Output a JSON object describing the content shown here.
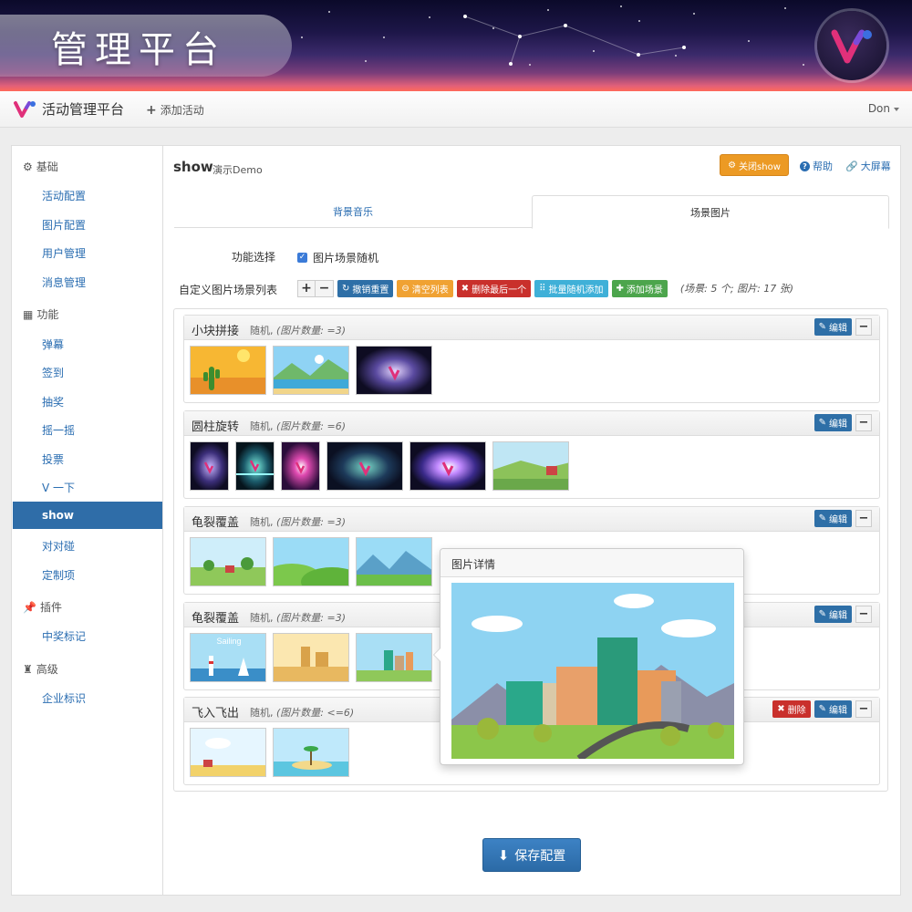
{
  "banner": {
    "title": "管理平台"
  },
  "navbar": {
    "brand": "活动管理平台",
    "add_activity": "添加活动",
    "user": "Don"
  },
  "sidebar": {
    "groups": [
      {
        "label": "基础",
        "icon": "gear-icon",
        "items": [
          "活动配置",
          "图片配置",
          "用户管理",
          "消息管理"
        ]
      },
      {
        "label": "功能",
        "icon": "grid-icon",
        "items": [
          "弹幕",
          "签到",
          "抽奖",
          "摇一摇",
          "投票",
          "V 一下",
          "show",
          "对对碰",
          "定制项"
        ]
      },
      {
        "label": "插件",
        "icon": "pin-icon",
        "items": [
          "中奖标记"
        ]
      },
      {
        "label": "高级",
        "icon": "stamp-icon",
        "items": [
          "企业标识"
        ]
      }
    ],
    "active": "show"
  },
  "main": {
    "title": "show",
    "subtitle": "演示Demo",
    "close_show": "关闭show",
    "help": "帮助",
    "big_screen": "大屏幕",
    "tabs": [
      "背景音乐",
      "场景图片"
    ],
    "active_tab": "场景图片",
    "func_label": "功能选择",
    "func_option": "图片场景随机",
    "list_label": "自定义图片场景列表",
    "toolbar": {
      "undo": "撤销重置",
      "clear": "清空列表",
      "delete_last": "删除最后一个",
      "batch_random": "批量随机添加",
      "add_scene": "添加场景",
      "stats": "(场景: 5 个;  图片: 17 张)"
    },
    "scenes": [
      {
        "name": "小块拼接",
        "mode": "随机,",
        "count": "(图片数量: =3)",
        "buttons": [
          "编辑"
        ]
      },
      {
        "name": "圆柱旋转",
        "mode": "随机,",
        "count": "(图片数量: =6)",
        "buttons": [
          "编辑"
        ]
      },
      {
        "name": "龟裂覆盖",
        "mode": "随机,",
        "count": "(图片数量: =3)",
        "buttons": [
          "编辑"
        ]
      },
      {
        "name": "龟裂覆盖",
        "mode": "随机,",
        "count": "(图片数量: =3)",
        "buttons": [
          "编辑"
        ]
      },
      {
        "name": "飞入飞出",
        "mode": "随机,",
        "count": "(图片数量: <=6)",
        "buttons": [
          "删除",
          "编辑"
        ]
      }
    ],
    "save": "保存配置"
  },
  "popover": {
    "title": "图片详情",
    "thumb_text": "Sailing"
  },
  "colors": {
    "primary": "#2f6da8",
    "orange": "#ec9a24",
    "red": "#c9302c",
    "cyan": "#3fb0d8",
    "green": "#4ca54c"
  }
}
